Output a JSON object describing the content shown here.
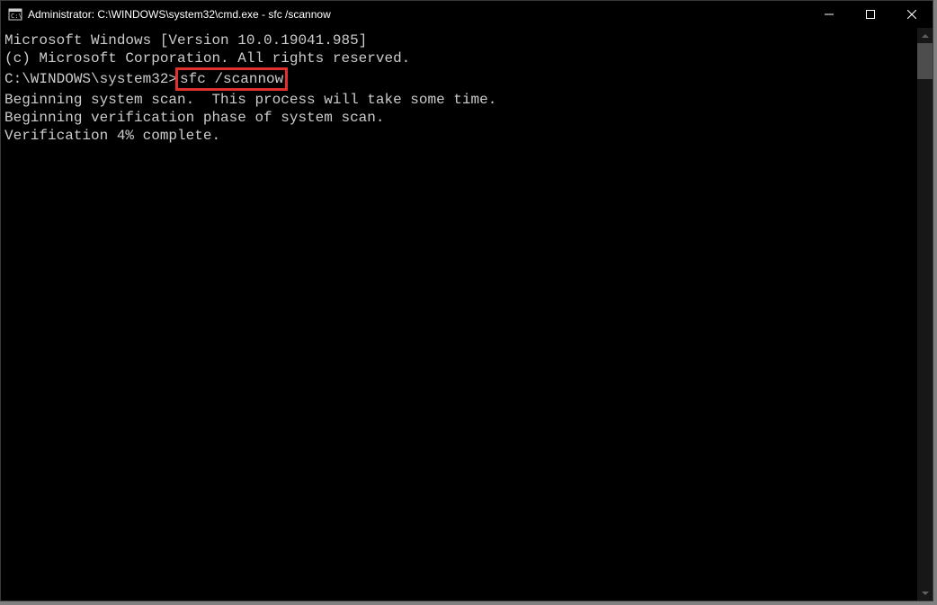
{
  "window": {
    "title": "Administrator: C:\\WINDOWS\\system32\\cmd.exe - sfc  /scannow"
  },
  "terminal": {
    "line1": "Microsoft Windows [Version 10.0.19041.985]",
    "line2": "(c) Microsoft Corporation. All rights reserved.",
    "line3": "",
    "prompt": "C:\\WINDOWS\\system32>",
    "command": "sfc /scannow",
    "line5": "",
    "line6": "Beginning system scan.  This process will take some time.",
    "line7": "",
    "line8": "Beginning verification phase of system scan.",
    "line9": "Verification 4% complete."
  }
}
